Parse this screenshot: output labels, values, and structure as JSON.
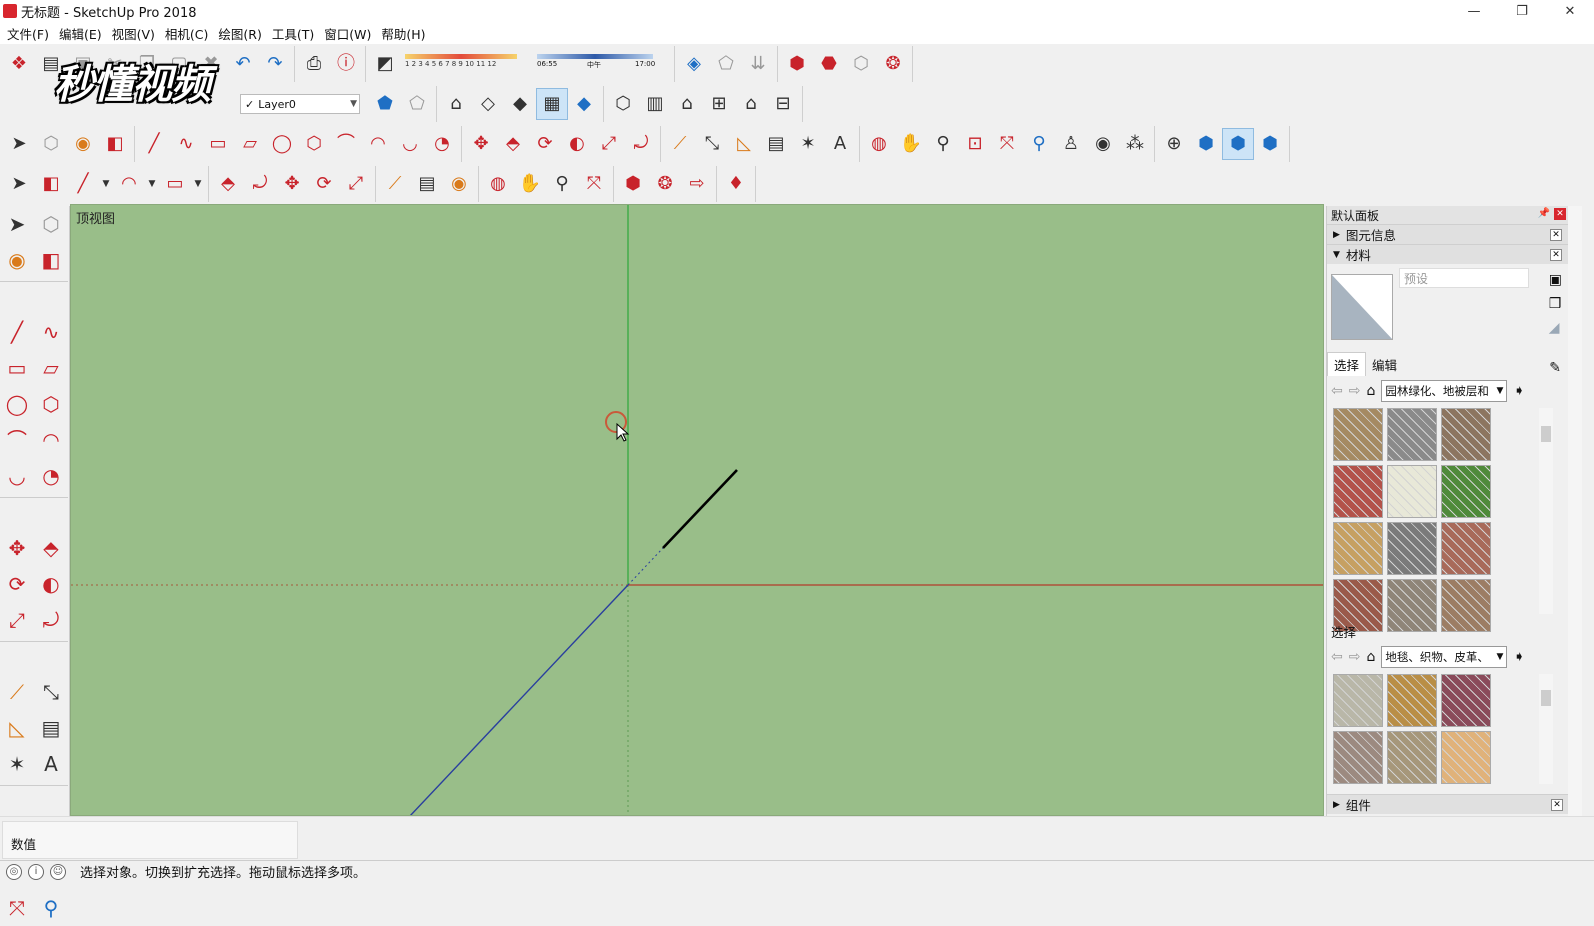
{
  "window": {
    "title": "无标题 - SketchUp Pro 2018",
    "controls": [
      "—",
      "❐",
      "✕"
    ]
  },
  "menu": [
    "文件(F)",
    "编辑(E)",
    "视图(V)",
    "相机(C)",
    "绘图(R)",
    "工具(T)",
    "窗口(W)",
    "帮助(H)"
  ],
  "watermark": "秒懂视频",
  "shadow_settings": {
    "months": "1 2 3 4 5 6 7 8 9 10 11 12",
    "time_start": "06:55",
    "time_mid": "中午",
    "time_end": "17:00"
  },
  "layer": {
    "current": "Layer0",
    "check": "✓"
  },
  "viewport": {
    "view_label": "顶视图",
    "background": "#99be89",
    "axis_colors": {
      "red": "#b33b2a",
      "green": "#2ea83a",
      "blue": "#2a3f9e"
    }
  },
  "value_box": {
    "label": "数值"
  },
  "status": {
    "text": "选择对象。切换到扩充选择。拖动鼠标选择多项。",
    "icons": [
      "geo-icon",
      "info-icon",
      "user-icon"
    ]
  },
  "tray": {
    "title": "默认面板",
    "sections": {
      "entity_info": "图元信息",
      "materials": "材料",
      "components": "组件"
    },
    "material_name_placeholder": "预设",
    "tabs": [
      "选择",
      "编辑"
    ],
    "library_1": "园林绿化、地被层和",
    "secondary_label": "选择",
    "library_2": "地毯、织物、皮革、",
    "swatches_1": [
      "#a58a62",
      "#8a8a8a",
      "#8c7560",
      "#b3524a",
      "#e8e8d8",
      "#4f8a3a",
      "#c6a062",
      "#7a7a7a",
      "#a86a5a",
      "#9a5a4a",
      "#8f8578",
      "#9c7d64"
    ],
    "swatches_2": [
      "#b9b7a8",
      "#b98e46",
      "#8a4a5a",
      "#9c8a80",
      "#a6977a",
      "#e0b27a"
    ]
  }
}
